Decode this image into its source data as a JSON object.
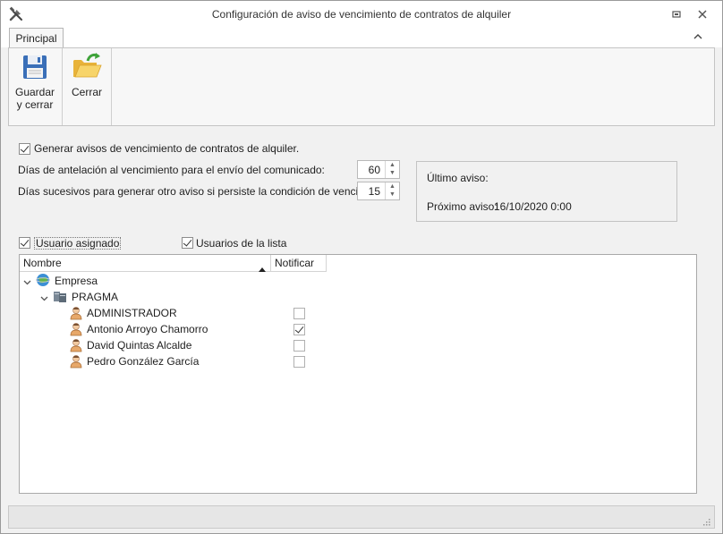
{
  "window": {
    "title": "Configuración de aviso de vencimiento de contratos de alquiler",
    "app_icon": "tools-icon"
  },
  "ribbon": {
    "tab_label": "Principal",
    "save_label_line1": "Guardar",
    "save_label_line2": "y cerrar",
    "close_label": "Cerrar"
  },
  "form": {
    "generate_label": "Generar avisos de vencimiento de contratos de alquiler.",
    "generate_checked": true,
    "days_before_label": "Días de antelación al vencimiento para el envío del comunicado:",
    "days_before_value": "60",
    "days_repeat_label": "Días sucesivos para generar otro aviso si persiste la condición de vencimiento:",
    "days_repeat_value": "15",
    "last_notice_label": "Último aviso:",
    "next_notice_label": "Próximo aviso:",
    "next_notice_value": "16/10/2020 0:00",
    "assigned_user_label": "Usuario asignado",
    "assigned_user_checked": true,
    "list_users_label": "Usuarios de la lista",
    "list_users_checked": true
  },
  "grid": {
    "columns": [
      "Nombre",
      "Notificar"
    ],
    "company": "Empresa",
    "group": "PRAGMA",
    "users": [
      {
        "name": "ADMINISTRADOR",
        "notify": false
      },
      {
        "name": "Antonio Arroyo Chamorro",
        "notify": true
      },
      {
        "name": "David Quintas Alcalde",
        "notify": false
      },
      {
        "name": "Pedro González García",
        "notify": false
      }
    ]
  }
}
